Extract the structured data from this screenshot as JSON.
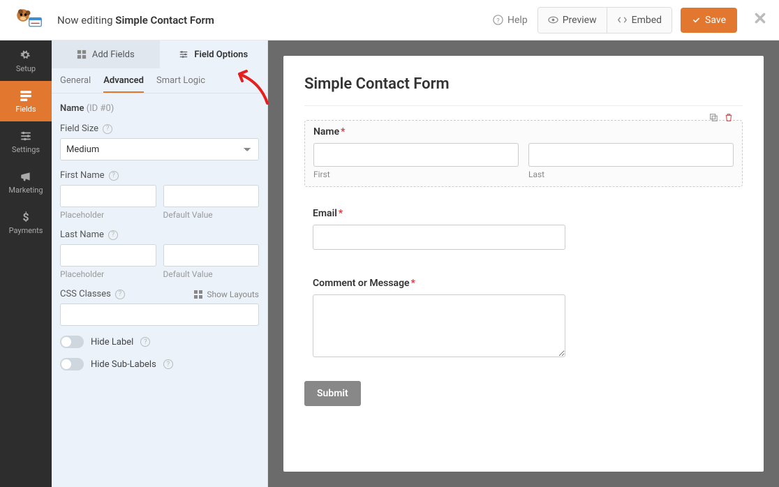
{
  "header": {
    "now_editing_prefix": "Now editing ",
    "form_title": "Simple Contact Form",
    "help": "Help",
    "preview": "Preview",
    "embed": "Embed",
    "save": "Save"
  },
  "nav": {
    "setup": "Setup",
    "fields": "Fields",
    "settings": "Settings",
    "marketing": "Marketing",
    "payments": "Payments"
  },
  "panel": {
    "tabs": {
      "add_fields": "Add Fields",
      "field_options": "Field Options"
    },
    "subtabs": {
      "general": "General",
      "advanced": "Advanced",
      "smart_logic": "Smart Logic"
    },
    "field_name_label": "Name",
    "field_id": " (ID #0)",
    "field_size_label": "Field Size",
    "field_size_value": "Medium",
    "first_name_label": "First Name",
    "last_name_label": "Last Name",
    "placeholder_sub": "Placeholder",
    "default_sub": "Default Value",
    "css_classes_label": "CSS Classes",
    "show_layouts": "Show Layouts",
    "hide_label": "Hide Label",
    "hide_sublabels": "Hide Sub-Labels"
  },
  "preview": {
    "title": "Simple Contact Form",
    "name_label": "Name",
    "first_sub": "First",
    "last_sub": "Last",
    "email_label": "Email",
    "comment_label": "Comment or Message",
    "submit": "Submit"
  }
}
